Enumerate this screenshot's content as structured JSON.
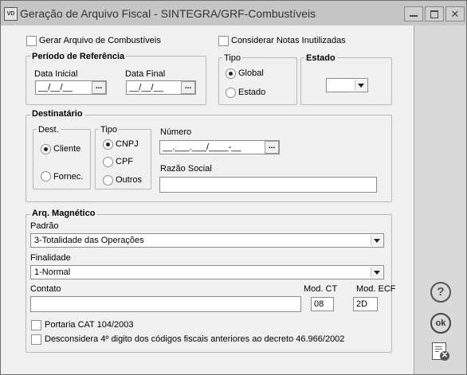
{
  "window": {
    "icon_text": "VD",
    "title": "Geração de Arquivo Fiscal - SINTEGRA/GRF-Combustíveis"
  },
  "options": {
    "gerar_combustiveis": "Gerar Arquivo de Combustíveis",
    "considerar_inutilizadas": "Considerar Notas Inutilizadas"
  },
  "periodo": {
    "title": "Período de Referência",
    "data_inicial_label": "Data Inicial",
    "data_inicial_value": "__/__/__",
    "data_final_label": "Data Final",
    "data_final_value": "__/__/__",
    "button_text": "..."
  },
  "tipo": {
    "title": "Tipo",
    "global": "Global",
    "estado": "Estado",
    "selected": "Global"
  },
  "estado": {
    "title": "Estado",
    "value": ""
  },
  "destinatario": {
    "title": "Destinatário",
    "dest_title": "Dest.",
    "cliente": "Cliente",
    "fornec": "Fornec.",
    "dest_selected": "Cliente",
    "tipo_title": "Tipo",
    "cnpj": "CNPJ",
    "cpf": "CPF",
    "outros": "Outros",
    "tipo_selected": "CNPJ",
    "numero_label": "Número",
    "numero_value": "__.___.___/____-__",
    "button_text": "...",
    "razao_label": "Razão Social",
    "razao_value": ""
  },
  "arq": {
    "title": "Arq. Magnético",
    "padrao_label": "Padrão",
    "padrao_value": "3-Totalidade das Operações",
    "finalidade_label": "Finalidade",
    "finalidade_value": "1-Normal",
    "contato_label": "Contato",
    "contato_value": "",
    "mod_ct_label": "Mod. CT",
    "mod_ct_value": "08",
    "mod_ecf_label": "Mod. ECF",
    "mod_ecf_value": "2D",
    "portaria": "Portaria CAT 104/2003",
    "desconsidera": "Desconsidera 4º digito dos códigos fiscais anteriores ao decreto 46.966/2002"
  },
  "sidebar": {
    "help_glyph": "?",
    "ok_glyph": "ok",
    "cancel_glyph": "✕"
  },
  "titlebar_buttons": {
    "close_glyph": "✕"
  }
}
